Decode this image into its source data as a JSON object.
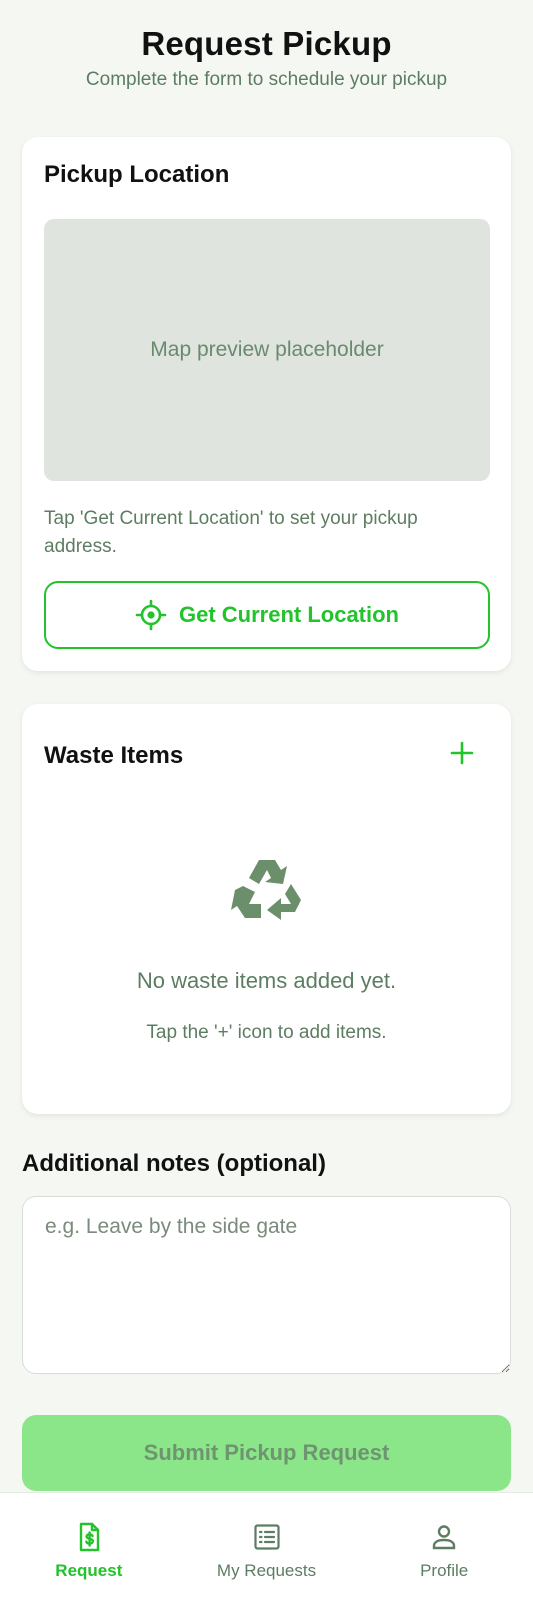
{
  "header": {
    "title": "Request Pickup",
    "subtitle": "Complete the form to schedule your pickup"
  },
  "location_card": {
    "title": "Pickup Location",
    "map_placeholder": "Map preview placeholder",
    "hint": "Tap 'Get Current Location' to set your pickup address.",
    "button_label": "Get Current Location",
    "button_icon": "crosshair-icon"
  },
  "waste_card": {
    "title": "Waste Items",
    "add_icon": "plus-icon",
    "empty_icon": "recycle-icon",
    "empty_title": "No waste items added yet.",
    "empty_subtitle": "Tap the '+' icon to add items."
  },
  "notes": {
    "label": "Additional notes (optional)",
    "placeholder": "e.g. Leave by the side gate",
    "value": ""
  },
  "submit": {
    "label": "Submit Pickup Request",
    "enabled": false
  },
  "bottom_nav": {
    "items": [
      {
        "label": "Request",
        "icon": "document-dollar-icon",
        "active": true
      },
      {
        "label": "My Requests",
        "icon": "list-icon",
        "active": false
      },
      {
        "label": "Profile",
        "icon": "person-icon",
        "active": false
      }
    ]
  },
  "colors": {
    "accent": "#22c32b",
    "muted_green": "#5d7d62",
    "submit_disabled_bg": "#8be68a",
    "background": "#f5f7f3"
  }
}
